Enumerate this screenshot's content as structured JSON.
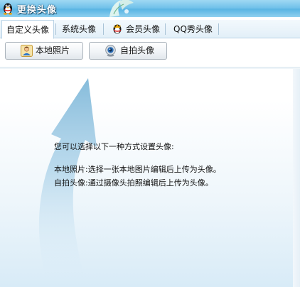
{
  "window": {
    "title": "更换头像"
  },
  "tabs": [
    {
      "label": "自定义头像",
      "active": true
    },
    {
      "label": "系统头像",
      "active": false
    },
    {
      "label": "会员头像",
      "active": false,
      "icon": "vip-icon"
    },
    {
      "label": "QQ秀头像",
      "active": false
    }
  ],
  "toolbar": {
    "local_photo": {
      "label": "本地照片",
      "icon": "user-photo-icon"
    },
    "selfie": {
      "label": "自拍头像",
      "icon": "webcam-icon"
    }
  },
  "instructions": {
    "intro": "您可以选择以下一种方式设置头像:",
    "local": "本地照片:选择一张本地图片编辑后上传为头像。",
    "selfie": "自拍头像:通过摄像头拍照编辑后上传为头像。"
  },
  "colors": {
    "titlebar": "#73c2ea",
    "arrow": "#7fb8d9",
    "background_bottom": "#d8ebf7"
  }
}
